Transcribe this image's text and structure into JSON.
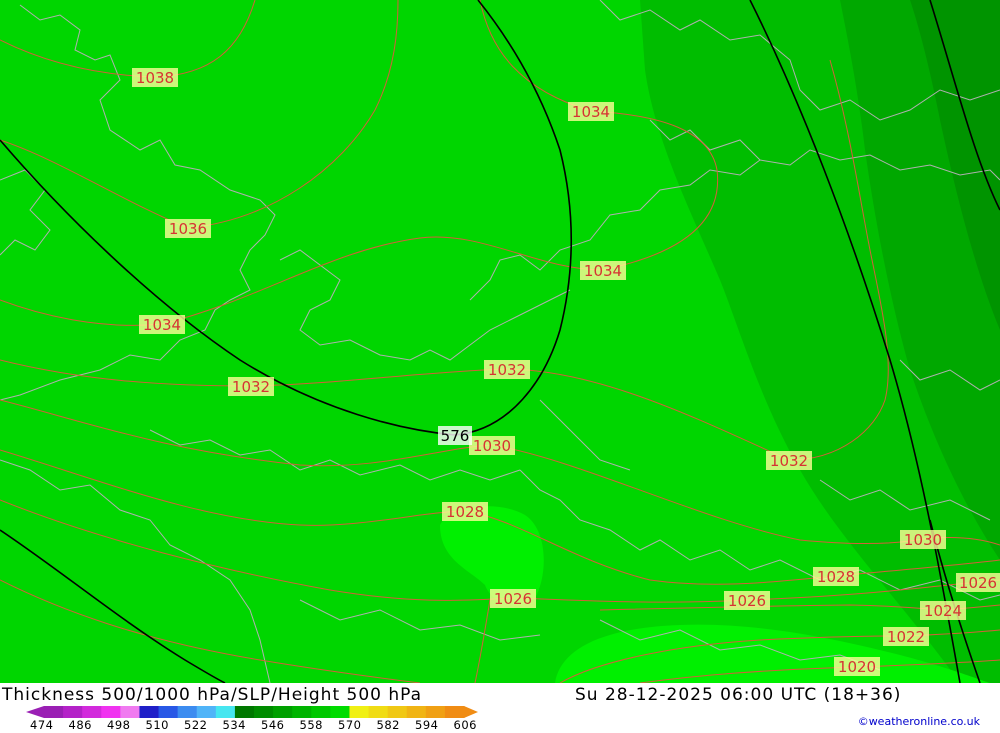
{
  "title": "Thickness 500/1000 hPa/SLP/Height 500 hPa",
  "datetime": "Su 28-12-2025 06:00 UTC (18+36)",
  "credit": "©weatheronline.co.uk",
  "colors": {
    "base_green": "#00d600",
    "dark_green_1": "#00bd00",
    "dark_green_2": "#00a800",
    "dark_green_3": "#009400",
    "light_green": "#00f000",
    "isobar": "#d2603a",
    "height_line": "#000000",
    "coastline": "#b0b0b0"
  },
  "isobar_labels": [
    {
      "id": "iso-1038",
      "text": "1038"
    },
    {
      "id": "iso-1034-a",
      "text": "1034"
    },
    {
      "id": "iso-1036",
      "text": "1036"
    },
    {
      "id": "iso-1034-b",
      "text": "1034"
    },
    {
      "id": "iso-1034-c",
      "text": "1034"
    },
    {
      "id": "iso-1032-a",
      "text": "1032"
    },
    {
      "id": "iso-1032-b",
      "text": "1032"
    },
    {
      "id": "iso-1030-a",
      "text": "1030"
    },
    {
      "id": "iso-1032-c",
      "text": "1032"
    },
    {
      "id": "iso-1028-a",
      "text": "1028"
    },
    {
      "id": "iso-1030-b",
      "text": "1030"
    },
    {
      "id": "iso-1028-b",
      "text": "1028"
    },
    {
      "id": "iso-1026-a",
      "text": "1026"
    },
    {
      "id": "iso-1026-b",
      "text": "1026"
    },
    {
      "id": "iso-1026-c",
      "text": "1026"
    },
    {
      "id": "iso-1024",
      "text": "1024"
    },
    {
      "id": "iso-1022",
      "text": "1022"
    },
    {
      "id": "iso-1020",
      "text": "1020"
    }
  ],
  "height_label": "576",
  "legend": {
    "colors": [
      "#9a1fb4",
      "#b422c8",
      "#d22adc",
      "#f032f0",
      "#f07af0",
      "#2020c8",
      "#2858e6",
      "#3c8cf0",
      "#50b4f8",
      "#46e6f0",
      "#007800",
      "#008c00",
      "#00a000",
      "#00b400",
      "#00c800",
      "#00dc00",
      "#f0f014",
      "#f0dc14",
      "#f0c814",
      "#f0b414",
      "#f0a014",
      "#f08c14"
    ],
    "ticks": [
      "474",
      "486",
      "498",
      "510",
      "522",
      "534",
      "546",
      "558",
      "570",
      "582",
      "594",
      "606"
    ]
  }
}
